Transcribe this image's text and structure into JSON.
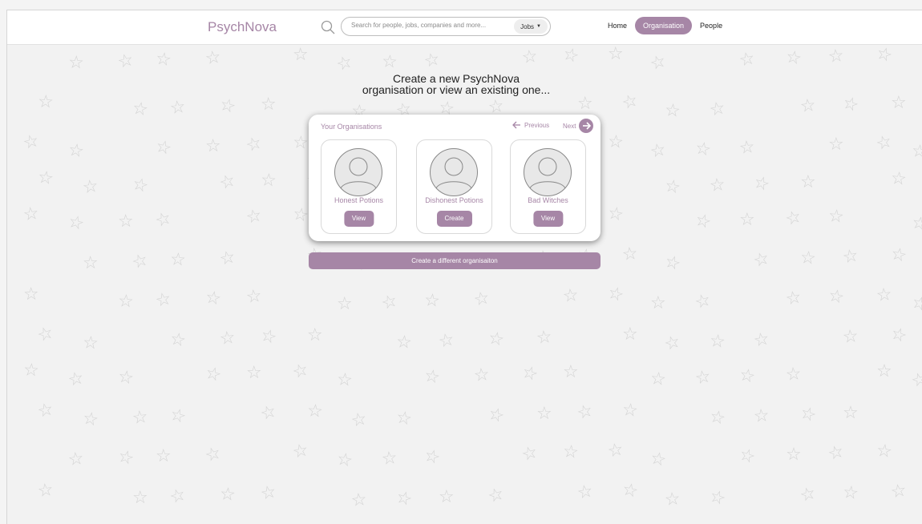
{
  "app": {
    "name": "PsychNova"
  },
  "search": {
    "placeholder": "Search for people, jobs, companies and more...",
    "filter_value": "Jobs"
  },
  "nav": {
    "items": [
      {
        "label": "Home"
      },
      {
        "label": "Organisation",
        "active": true
      },
      {
        "label": "People"
      }
    ]
  },
  "page": {
    "heading_line1": "Create a new PsychNova",
    "heading_line2": "organisation or view an existing one..."
  },
  "organisations": {
    "title": "Your Organisations",
    "prev_label": "Previous",
    "next_label": "Next",
    "items": [
      {
        "name": "Honest Potions",
        "action": "View"
      },
      {
        "name": "Dishonest Potions",
        "action": "Create"
      },
      {
        "name": "Bad Witches",
        "action": "View"
      }
    ]
  },
  "create_different_label": "Create a different organisaiton",
  "icons": {
    "search": "search-icon",
    "prev": "arrow-left-icon",
    "next": "arrow-right-circle-icon",
    "avatar": "user-avatar-icon",
    "jobs_dropdown": "caret-down-icon",
    "background": "star-icon"
  },
  "colors": {
    "accent": "#a686a6",
    "background": "#f2f2f2",
    "star": "#d4d4d4"
  }
}
